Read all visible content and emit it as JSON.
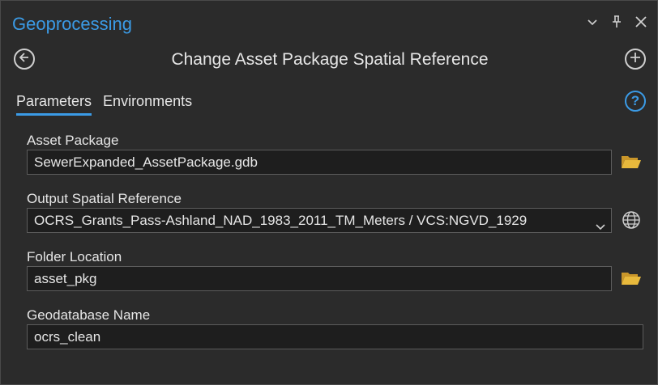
{
  "pane": {
    "title": "Geoprocessing",
    "icons": [
      "chevron-down-icon",
      "pin-icon",
      "close-icon"
    ]
  },
  "tool": {
    "title": "Change Asset Package Spatial Reference",
    "back_icon": "back-icon",
    "add_icon": "add-icon"
  },
  "tabs": [
    {
      "label": "Parameters",
      "active": true
    },
    {
      "label": "Environments",
      "active": false
    }
  ],
  "help_icon": "help-icon",
  "params": {
    "asset_package": {
      "label": "Asset Package",
      "value": "SewerExpanded_AssetPackage.gdb",
      "icon": "folder-icon"
    },
    "spatial_ref": {
      "label": "Output Spatial Reference",
      "value": "OCRS_Grants_Pass-Ashland_NAD_1983_2011_TM_Meters / VCS:NGVD_1929",
      "icon": "globe-icon"
    },
    "folder": {
      "label": "Folder Location",
      "value": "asset_pkg",
      "icon": "folder-icon"
    },
    "gdb_name": {
      "label": "Geodatabase Name",
      "value": "ocrs_clean"
    }
  },
  "colors": {
    "accent": "#3b9be6",
    "background": "#2b2b2b",
    "field_bg": "#1e1e1e",
    "folder": "#e8b93c"
  }
}
